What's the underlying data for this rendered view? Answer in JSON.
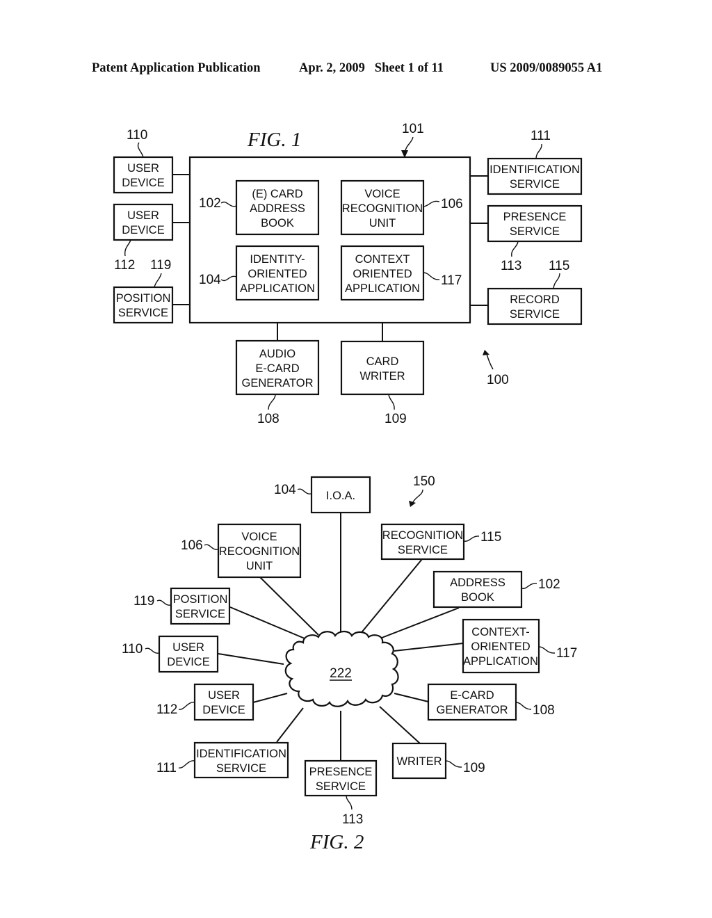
{
  "header": {
    "publication": "Patent Application Publication",
    "date_sheet": "Apr. 2, 2009   Sheet 1 of 11",
    "number": "US 2009/0089055 A1"
  },
  "fig1": {
    "title": "FIG. 1",
    "system_ref": "101",
    "overall_ref": "100",
    "inner_blocks": [
      {
        "id": "ecard-address-book",
        "lines": [
          "(E) CARD",
          "ADDRESS",
          "BOOK"
        ],
        "ref": "102"
      },
      {
        "id": "identity-oriented-application",
        "lines": [
          "IDENTITY-",
          "ORIENTED",
          "APPLICATION"
        ],
        "ref": "104"
      },
      {
        "id": "voice-recognition-unit",
        "lines": [
          "VOICE",
          "RECOGNITION",
          "UNIT"
        ],
        "ref": "106"
      },
      {
        "id": "context-oriented-application",
        "lines": [
          "CONTEXT",
          "ORIENTED",
          "APPLICATION"
        ],
        "ref": "117"
      }
    ],
    "left_blocks": [
      {
        "id": "user-device-110",
        "lines": [
          "USER",
          "DEVICE"
        ],
        "ref": "110"
      },
      {
        "id": "user-device-112",
        "lines": [
          "USER",
          "DEVICE"
        ],
        "ref": "112"
      },
      {
        "id": "position-service",
        "lines": [
          "POSITION",
          "SERVICE"
        ],
        "ref": "119"
      }
    ],
    "right_blocks": [
      {
        "id": "identification-service",
        "lines": [
          "IDENTIFICATION",
          "SERVICE"
        ],
        "ref": "111"
      },
      {
        "id": "presence-service",
        "lines": [
          "PRESENCE",
          "SERVICE"
        ],
        "ref": "113"
      },
      {
        "id": "record-service",
        "lines": [
          "RECORD",
          "SERVICE"
        ],
        "ref": "115"
      }
    ],
    "bottom_blocks": [
      {
        "id": "audio-ecard-generator",
        "lines": [
          "AUDIO",
          "E-CARD",
          "GENERATOR"
        ],
        "ref": "108"
      },
      {
        "id": "card-writer",
        "lines": [
          "CARD",
          "WRITER"
        ],
        "ref": "109"
      }
    ]
  },
  "fig2": {
    "title": "FIG. 2",
    "overall_ref": "150",
    "network_label": "222",
    "nodes": [
      {
        "id": "ioa",
        "lines": [
          "I.O.A."
        ],
        "ref": "104"
      },
      {
        "id": "voice-recognition-unit",
        "lines": [
          "VOICE",
          "RECOGNITION",
          "UNIT"
        ],
        "ref": "106"
      },
      {
        "id": "recognition-service",
        "lines": [
          "RECOGNITION",
          "SERVICE"
        ],
        "ref": "115"
      },
      {
        "id": "address-book",
        "lines": [
          "ADDRESS",
          "BOOK"
        ],
        "ref": "102"
      },
      {
        "id": "position-service",
        "lines": [
          "POSITION",
          "SERVICE"
        ],
        "ref": "119"
      },
      {
        "id": "context-oriented-application",
        "lines": [
          "CONTEXT-",
          "ORIENTED",
          "APPLICATION"
        ],
        "ref": "117"
      },
      {
        "id": "user-device-110",
        "lines": [
          "USER",
          "DEVICE"
        ],
        "ref": "110"
      },
      {
        "id": "user-device-112",
        "lines": [
          "USER",
          "DEVICE"
        ],
        "ref": "112"
      },
      {
        "id": "ecard-generator",
        "lines": [
          "E-CARD",
          "GENERATOR"
        ],
        "ref": "108"
      },
      {
        "id": "identification-service",
        "lines": [
          "IDENTIFICATION",
          "SERVICE"
        ],
        "ref": "111"
      },
      {
        "id": "writer",
        "lines": [
          "WRITER"
        ],
        "ref": "109"
      },
      {
        "id": "presence-service",
        "lines": [
          "PRESENCE",
          "SERVICE"
        ],
        "ref": "113"
      }
    ]
  }
}
